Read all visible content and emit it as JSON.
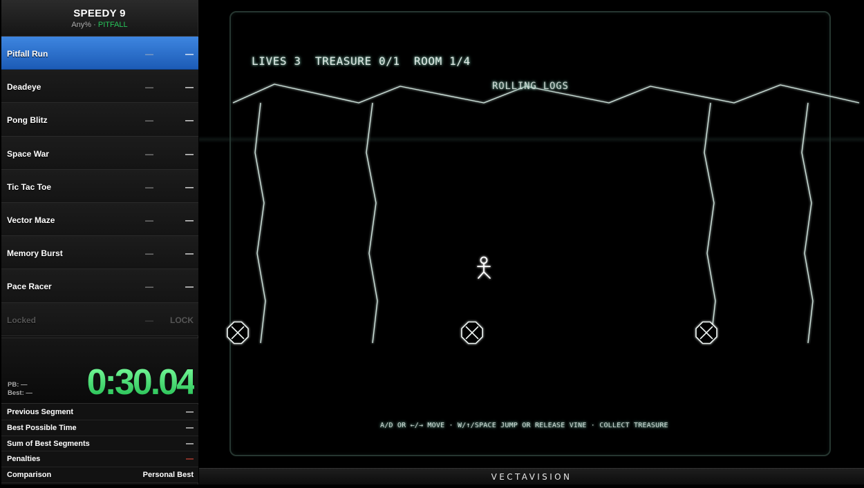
{
  "splits": {
    "title": "SPEEDY 9",
    "category": "Any%",
    "separator": " · ",
    "variant": "PITFALL",
    "segments": [
      {
        "name": "Pitfall Run",
        "delta": "—",
        "time": "—",
        "state": "active"
      },
      {
        "name": "Deadeye",
        "delta": "—",
        "time": "—",
        "state": "normal"
      },
      {
        "name": "Pong Blitz",
        "delta": "—",
        "time": "—",
        "state": "normal"
      },
      {
        "name": "Space War",
        "delta": "—",
        "time": "—",
        "state": "normal"
      },
      {
        "name": "Tic Tac Toe",
        "delta": "—",
        "time": "—",
        "state": "normal"
      },
      {
        "name": "Vector Maze",
        "delta": "—",
        "time": "—",
        "state": "normal"
      },
      {
        "name": "Memory Burst",
        "delta": "—",
        "time": "—",
        "state": "normal"
      },
      {
        "name": "Pace Racer",
        "delta": "—",
        "time": "—",
        "state": "normal"
      },
      {
        "name": "Locked",
        "delta": "—",
        "time": "LOCK",
        "state": "locked"
      }
    ],
    "timer": {
      "pb": "PB: —",
      "best": "Best: —",
      "value": "0:30.04",
      "color": "#35e070"
    },
    "info": [
      {
        "label": "Previous Segment",
        "value": "—"
      },
      {
        "label": "Best Possible Time",
        "value": "—"
      },
      {
        "label": "Sum of Best Segments",
        "value": "—"
      },
      {
        "label": "Penalties",
        "value": "—"
      },
      {
        "label": "Comparison",
        "value": "Personal Best"
      }
    ]
  },
  "game": {
    "hud": {
      "lives": "LIVES 3",
      "treasure": "TREASURE 0/1",
      "room": "ROOM 1/4"
    },
    "room_name": "ROLLING LOGS",
    "help": "A/D OR ←/→ MOVE · W/↑/SPACE JUMP OR RELEASE VINE · COLLECT TREASURE",
    "vector_color": "#dfe9e5",
    "objects": [
      "player-icon",
      "rolling-log-icon",
      "rolling-log-icon",
      "rolling-log-icon"
    ]
  },
  "footer": {
    "brand": "VECTAVISION"
  },
  "colors": {
    "active_split": "#2f74d0",
    "timer_green": "#35e070",
    "penalty_red": "#e24a3b",
    "variant_green": "#27c45a"
  }
}
